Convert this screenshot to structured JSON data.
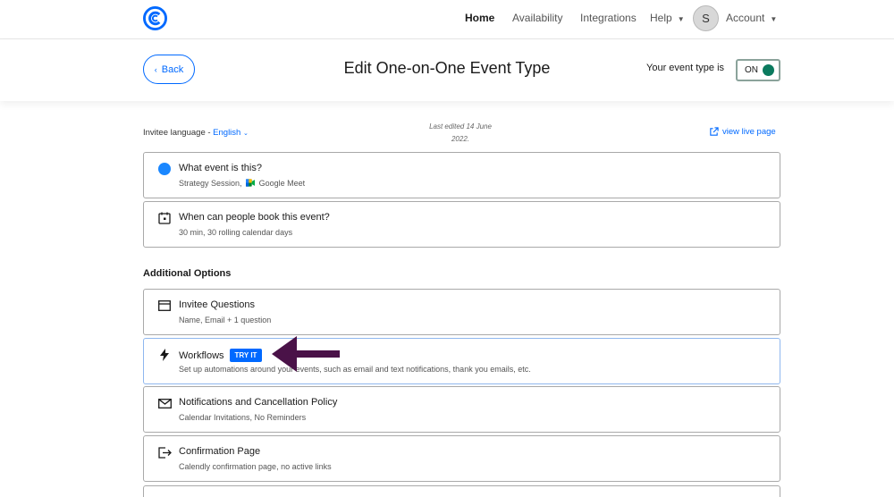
{
  "nav": {
    "items": [
      "Home",
      "Availability",
      "Integrations",
      "Help"
    ],
    "avatar_initial": "S",
    "account_label": "Account"
  },
  "header": {
    "back_label": "Back",
    "title": "Edit One-on-One Event Type",
    "status_label": "Your event type is",
    "toggle_label": "ON",
    "toggle_on": true
  },
  "meta": {
    "language_prefix": "Invitee language -",
    "language_value": "English",
    "last_edited_line1": "Last edited 14 June",
    "last_edited_line2": "2022.",
    "view_live_label": "view live page"
  },
  "main_cards": [
    {
      "title": "What event is this?",
      "subtitle_before": "Strategy Session,",
      "subtitle_after": "Google Meet"
    },
    {
      "title": "When can people book this event?",
      "subtitle": "30 min, 30 rolling calendar days"
    }
  ],
  "additional_heading": "Additional Options",
  "additional_cards": [
    {
      "title": "Invitee Questions",
      "subtitle": "Name, Email + 1 question",
      "icon": "form-icon"
    },
    {
      "title": "Workflows",
      "badge": "TRY IT",
      "subtitle": "Set up automations around your events, such as email and text notifications, thank you emails, etc.",
      "icon": "lightning-icon"
    },
    {
      "title": "Notifications and Cancellation Policy",
      "subtitle": "Calendar Invitations, No Reminders",
      "icon": "envelope-icon"
    },
    {
      "title": "Confirmation Page",
      "subtitle": "Calendly confirmation page, no active links",
      "icon": "exit-arrow-icon"
    }
  ],
  "colors": {
    "accent": "#0069ff",
    "toggle_green": "#0b7a5e",
    "annotation_arrow": "#4a1248"
  }
}
